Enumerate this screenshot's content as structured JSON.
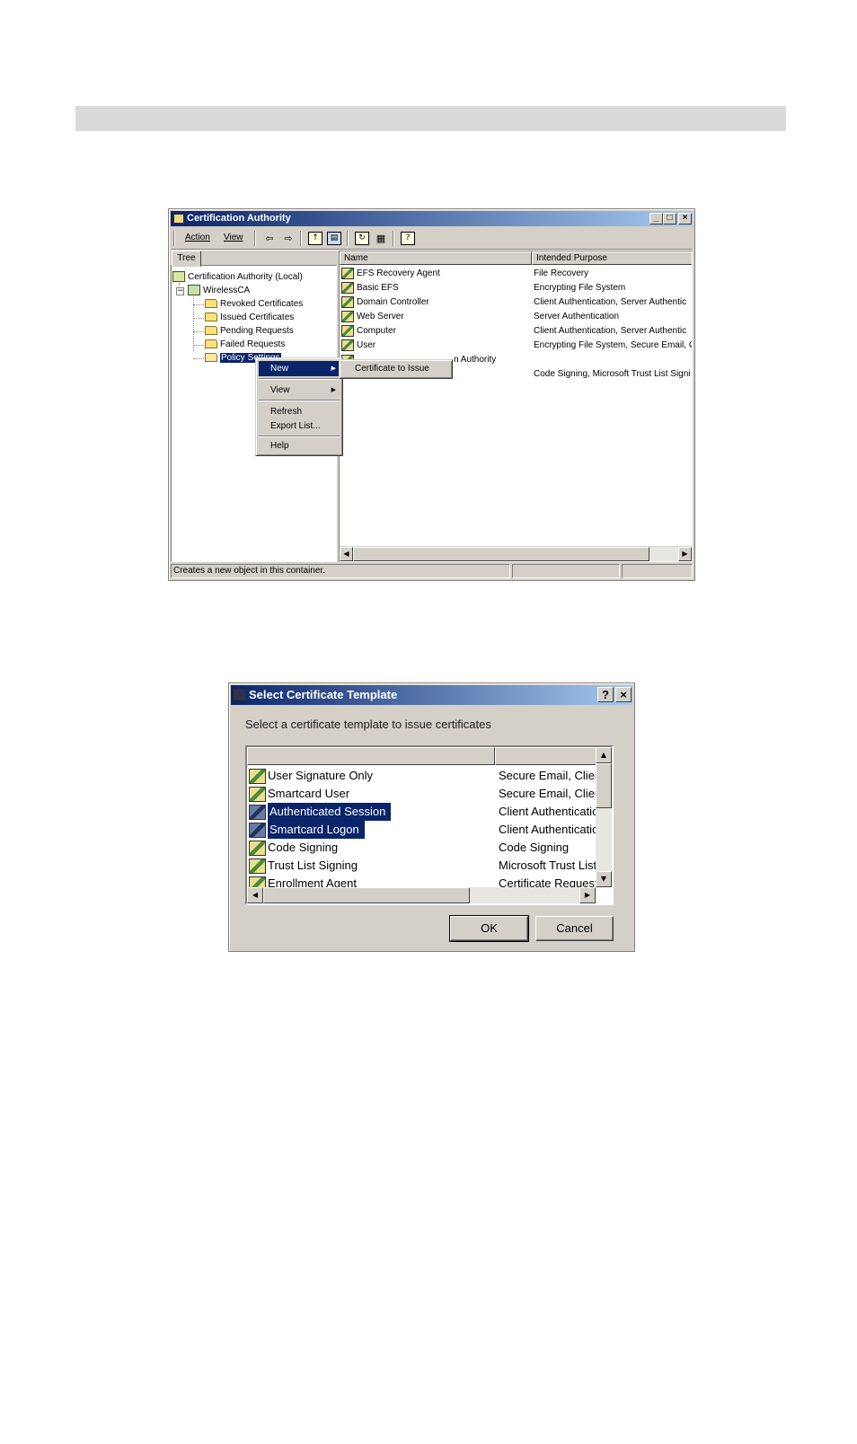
{
  "ca_window": {
    "title": "Certification Authority",
    "controls": {
      "minimize": "_",
      "maximize": "□",
      "close": "×"
    },
    "toolbar": {
      "action": "Action",
      "view": "View"
    },
    "tree_tab": "Tree",
    "tree": {
      "root": "Certification Authority (Local)",
      "ca": "WirelessCA",
      "folders": [
        "Revoked Certificates",
        "Issued Certificates",
        "Pending Requests",
        "Failed Requests",
        "Policy Settings"
      ]
    },
    "list_headers": {
      "name": "Name",
      "purpose": "Intended Purpose"
    },
    "list_rows": [
      {
        "name": "EFS Recovery Agent",
        "purpose": "File Recovery"
      },
      {
        "name": "Basic EFS",
        "purpose": "Encrypting File System"
      },
      {
        "name": "Domain Controller",
        "purpose": "Client Authentication, Server Authentic"
      },
      {
        "name": "Web Server",
        "purpose": "Server Authentication"
      },
      {
        "name": "Computer",
        "purpose": "Client Authentication, Server Authentic"
      },
      {
        "name": "User",
        "purpose": "Encrypting File System, Secure Email, C"
      },
      {
        "name": "Subordinate Certification Authority",
        "purpose": ""
      },
      {
        "name": "",
        "purpose": "Code Signing, Microsoft Trust List Signi"
      }
    ],
    "row6_visible_tail": "n Authority",
    "context_menu": {
      "new": "New",
      "view": "View",
      "refresh": "Refresh",
      "export": "Export List...",
      "help": "Help"
    },
    "submenu": {
      "item": "Certificate to Issue"
    },
    "status": "Creates a new object in this container."
  },
  "template_dialog": {
    "title": "Select Certificate Template",
    "help_button": "?",
    "close_button": "×",
    "prompt": "Select a certificate template to issue certificates",
    "rows": [
      {
        "name": "User Signature Only",
        "purpose": "Secure Email, Clien",
        "selected": false
      },
      {
        "name": "Smartcard User",
        "purpose": "Secure Email, Clien",
        "selected": false
      },
      {
        "name": "Authenticated Session",
        "purpose": "Client Authenticatic",
        "selected": true
      },
      {
        "name": "Smartcard Logon",
        "purpose": "Client Authenticatic",
        "selected": true
      },
      {
        "name": "Code Signing",
        "purpose": "Code Signing",
        "selected": false
      },
      {
        "name": "Trust List Signing",
        "purpose": "Microsoft Trust List",
        "selected": false
      },
      {
        "name": "Enrollment Agent",
        "purpose": "Certificate Request",
        "selected": false
      }
    ],
    "ok": "OK",
    "cancel": "Cancel"
  },
  "colors": {
    "selection": "#0a246a",
    "title_start": "#0a246a",
    "title_end": "#a6caf0",
    "face": "#d4d0c8"
  }
}
